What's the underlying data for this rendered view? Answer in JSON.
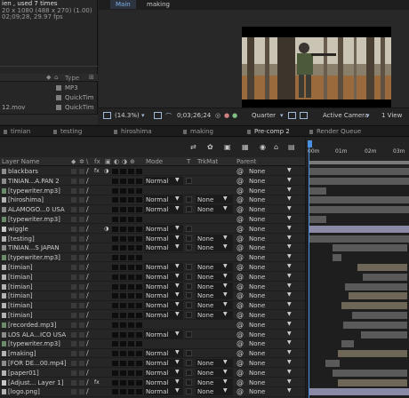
{
  "project": {
    "info": {
      "name": "ien , used 7 times",
      "line2": "20 x 1080 (488 x 270) (1.00)",
      "line3": "02;09;28, 29.97 fps"
    },
    "column_type": "Type",
    "items": [
      {
        "name": "",
        "type": "MP3"
      },
      {
        "name": "",
        "type": "QuickTim"
      },
      {
        "name": "12.mov",
        "type": "QuickTim"
      }
    ]
  },
  "viewer": {
    "tabs": [
      "Main",
      "making"
    ],
    "zoom": "(14.3%)",
    "timecode": "0;03;26;24",
    "resolution": "Quarter",
    "camera": "Active Camera",
    "views": "1 View"
  },
  "comp_tabs": [
    "timian",
    "testing",
    "hiroshima",
    "making",
    "Pre-comp 2",
    "Render Queue"
  ],
  "timeline": {
    "col_layer_name": "Layer Name",
    "col_mode": "Mode",
    "col_t": "T",
    "col_trkmat": "TrkMat",
    "col_parent": "Parent",
    "ruler_labels": [
      "00m",
      "01m",
      "02m",
      "03m"
    ],
    "layers": [
      {
        "name": "blackbars",
        "label": "#8c8c8c",
        "mode": "",
        "trk": "",
        "parent": "None",
        "fx": "fx",
        "adj": true
      },
      {
        "name": "TINIAN...A.PAN 2",
        "label": "#8c8c8c",
        "mode": "Normal",
        "trk": "",
        "parent": "None"
      },
      {
        "name": "[typewriter.mp3]",
        "label": "#6b8c6b",
        "mode": "",
        "trk": "",
        "parent": "None"
      },
      {
        "name": "[hiroshima]",
        "label": "#b4b4b4",
        "mode": "Normal",
        "trk": "None",
        "parent": "None"
      },
      {
        "name": "ALAMOGO...0 USA",
        "label": "#8c8c8c",
        "mode": "Normal",
        "trk": "None",
        "parent": "None"
      },
      {
        "name": "[typewriter.mp3]",
        "label": "#6b8c6b",
        "mode": "",
        "trk": "",
        "parent": "None"
      },
      {
        "name": "wiggle",
        "label": "#c8c8c8",
        "mode": "Normal",
        "trk": "",
        "parent": "None",
        "fx": "",
        "adj": true
      },
      {
        "name": "[testing]",
        "label": "#b4b4b4",
        "mode": "Normal",
        "trk": "None",
        "parent": "None"
      },
      {
        "name": "TINIAN...S JAPAN",
        "label": "#8c8c8c",
        "mode": "Normal",
        "trk": "None",
        "parent": "None"
      },
      {
        "name": "[typewriter.mp3]",
        "label": "#6b8c6b",
        "mode": "",
        "trk": "",
        "parent": "None"
      },
      {
        "name": "[timian]",
        "label": "#b4b4b4",
        "mode": "Normal",
        "trk": "None",
        "parent": "None"
      },
      {
        "name": "[timian]",
        "label": "#b4b4b4",
        "mode": "Normal",
        "trk": "None",
        "parent": "None"
      },
      {
        "name": "[timian]",
        "label": "#b4b4b4",
        "mode": "Normal",
        "trk": "None",
        "parent": "None"
      },
      {
        "name": "[timian]",
        "label": "#b4b4b4",
        "mode": "Normal",
        "trk": "None",
        "parent": "None"
      },
      {
        "name": "[timian]",
        "label": "#b4b4b4",
        "mode": "Normal",
        "trk": "None",
        "parent": "None"
      },
      {
        "name": "[timian]",
        "label": "#b4b4b4",
        "mode": "Normal",
        "trk": "None",
        "parent": "None"
      },
      {
        "name": "[recorded.mp3]",
        "label": "#6b8c6b",
        "mode": "",
        "trk": "",
        "parent": "None"
      },
      {
        "name": "LOS ALA...ICO USA",
        "label": "#8c8c8c",
        "mode": "Normal",
        "trk": "",
        "parent": "None"
      },
      {
        "name": "[typewriter.mp3]",
        "label": "#6b8c6b",
        "mode": "",
        "trk": "",
        "parent": "None"
      },
      {
        "name": "[making]",
        "label": "#b4b4b4",
        "mode": "Normal",
        "trk": "",
        "parent": "None"
      },
      {
        "name": "[FOR DE...00.mp4]",
        "label": "#8c8c8c",
        "mode": "Normal",
        "trk": "None",
        "parent": "None"
      },
      {
        "name": "[paper01]",
        "label": "#b4b4b4",
        "mode": "Normal",
        "trk": "None",
        "parent": "None"
      },
      {
        "name": "[Adjust... Layer 1]",
        "label": "#c8c8c8",
        "mode": "Normal",
        "trk": "None",
        "parent": "None",
        "fx": "fx"
      },
      {
        "name": "[logo.png]",
        "label": "#b4b4b4",
        "mode": "Normal",
        "trk": "None",
        "parent": "None"
      }
    ]
  },
  "colors": {
    "accent": "#4a90e2",
    "panel": "#262626",
    "bar_grey": "#5a5a5a",
    "bar_tan": "#6e6656",
    "bar_lav": "#8a8aa6"
  }
}
